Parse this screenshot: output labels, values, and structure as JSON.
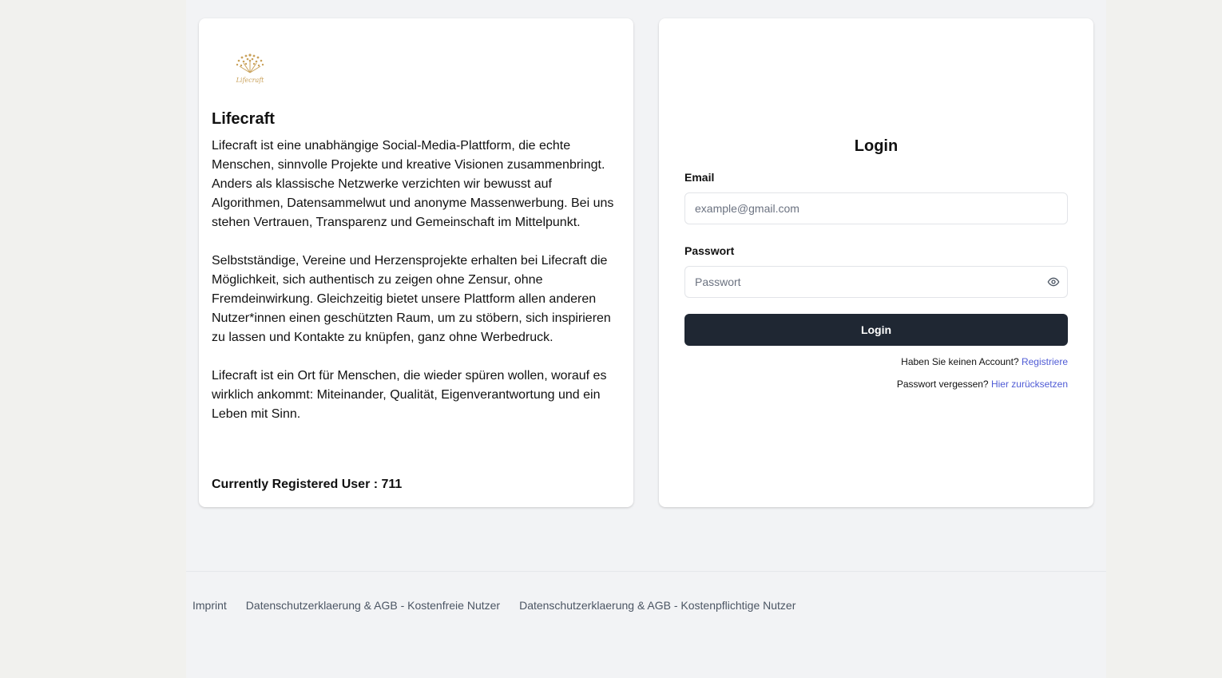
{
  "info": {
    "logo_text": "Lifecraft",
    "title": "Lifecraft",
    "paragraphs": [
      "Lifecraft ist eine unabhängige Social-Media-Plattform, die echte Menschen, sinnvolle Projekte und kreative Visionen zusammenbringt. Anders als klassische Netzwerke verzichten wir bewusst auf Algorithmen, Datensammelwut und anonyme Massenwerbung. Bei uns stehen Vertrauen, Transparenz und Gemeinschaft im Mittelpunkt.",
      "Selbstständige, Vereine und Herzensprojekte erhalten bei Lifecraft die Möglichkeit, sich authentisch zu zeigen ohne Zensur, ohne Fremdeinwirkung. Gleichzeitig bietet unsere Plattform allen anderen Nutzer*innen einen geschützten Raum, um zu stöbern, sich inspirieren zu lassen und Kontakte zu knüpfen, ganz ohne Werbedruck.",
      "Lifecraft ist ein Ort für Menschen, die wieder spüren wollen, worauf es wirklich ankommt: Miteinander, Qualität, Eigenverantwortung und ein Leben mit Sinn."
    ],
    "registered_users": "Currently Registered User : 711"
  },
  "login": {
    "title": "Login",
    "email_label": "Email",
    "email_placeholder": "example@gmail.com",
    "email_value": "",
    "password_label": "Passwort",
    "password_placeholder": "Passwort",
    "password_value": "",
    "password_toggle_icon": "eye-icon",
    "submit_label": "Login",
    "no_account_text": "Haben Sie keinen Account?",
    "register_link": "Registriere",
    "forgot_text": "Passwort vergessen?",
    "reset_link": "Hier zurücksetzen"
  },
  "footer": {
    "links": [
      "Imprint",
      "Datenschutzerklaerung & AGB - Kostenfreie Nutzer",
      "Datenschutzerklaerung & AGB - Kostenpflichtige Nutzer"
    ]
  },
  "colors": {
    "button_bg": "#1f2733",
    "link": "#4f5bd5",
    "logo_gold": "#c9a15a"
  }
}
